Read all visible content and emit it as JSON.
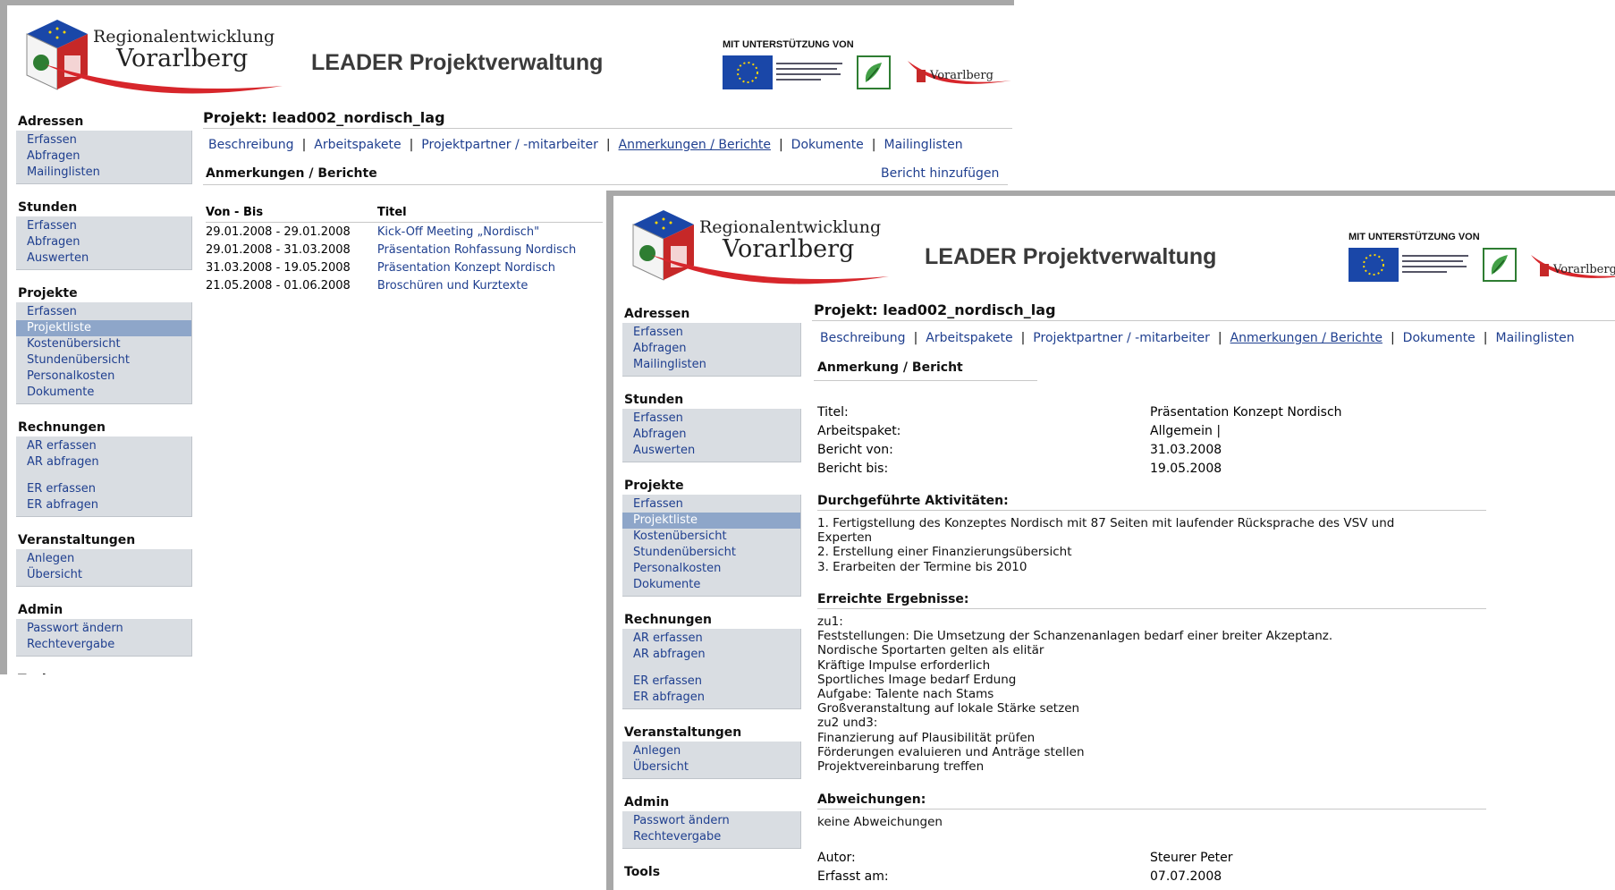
{
  "header": {
    "logo_line1": "Regionalentwicklung",
    "logo_line2": "Vorarlberg",
    "app_title": "LEADER Projektverwaltung",
    "support_label": "MIT UNTERSTÜTZUNG VON",
    "partner_label": "Vorarlberg"
  },
  "sidebar": {
    "adressen": {
      "title": "Adressen",
      "items": [
        "Erfassen",
        "Abfragen",
        "Mailinglisten"
      ]
    },
    "stunden": {
      "title": "Stunden",
      "items": [
        "Erfassen",
        "Abfragen",
        "Auswerten"
      ]
    },
    "projekte": {
      "title": "Projekte",
      "items": [
        "Erfassen",
        "Projektliste",
        "Kostenübersicht",
        "Stundenübersicht",
        "Personalkosten",
        "Dokumente"
      ]
    },
    "rechnungen": {
      "title": "Rechnungen",
      "items": [
        "AR erfassen",
        "AR abfragen",
        "ER erfassen",
        "ER abfragen"
      ]
    },
    "veranstaltungen": {
      "title": "Veranstaltungen",
      "items": [
        "Anlegen",
        "Übersicht"
      ]
    },
    "admin": {
      "title": "Admin",
      "items": [
        "Passwort ändern",
        "Rechtevergabe"
      ]
    },
    "tools": {
      "title": "Tools"
    }
  },
  "project": {
    "title": "Projekt: lead002_nordisch_lag",
    "tabs": [
      "Beschreibung",
      "Arbeitspakete",
      "Projektpartner / -mitarbeiter",
      "Anmerkungen / Berichte",
      "Dokumente",
      "Mailinglisten"
    ]
  },
  "list_view": {
    "subtitle": "Anmerkungen / Berichte",
    "add_link": "Bericht hinzufügen",
    "columns": [
      "Von - Bis",
      "Titel"
    ],
    "rows": [
      {
        "range": "29.01.2008 - 29.01.2008",
        "title": "Kick-Off Meeting „Nordisch\""
      },
      {
        "range": "29.01.2008 - 31.03.2008",
        "title": "Präsentation Rohfassung Nordisch"
      },
      {
        "range": "31.03.2008 - 19.05.2008",
        "title": "Präsentation Konzept Nordisch"
      },
      {
        "range": "21.05.2008 - 01.06.2008",
        "title": "Broschüren und Kurztexte"
      }
    ]
  },
  "detail_view": {
    "subtitle": "Anmerkung / Bericht",
    "fields": [
      {
        "k": "Titel:",
        "v": "Präsentation Konzept Nordisch"
      },
      {
        "k": "Arbeitspaket:",
        "v": "Allgemein |"
      },
      {
        "k": "Bericht von:",
        "v": "31.03.2008"
      },
      {
        "k": "Bericht bis:",
        "v": "19.05.2008"
      }
    ],
    "activities_title": "Durchgeführte Aktivitäten:",
    "activities": "1. Fertigstellung des Konzeptes Nordisch mit 87 Seiten mit laufender Rücksprache des VSV und\nExperten\n2. Erstellung einer Finanzierungsübersicht\n3. Erarbeiten der Termine bis 2010",
    "results_title": "Erreichte Ergebnisse:",
    "results": "zu1:\nFeststellungen: Die Umsetzung der Schanzenanlagen bedarf einer breiter Akzeptanz.\nNordische Sportarten gelten als elitär\nKräftige Impulse erforderlich\nSportliches Image bedarf Erdung\nAufgabe: Talente nach Stams\nGroßveranstaltung auf lokale Stärke setzen\nzu2 und3:\nFinanzierung auf Plausibilität prüfen\nFörderungen evaluieren und Anträge stellen\nProjektvereinbarung treffen",
    "deviations_title": "Abweichungen:",
    "deviations": "keine Abweichungen",
    "meta": [
      {
        "k": "Autor:",
        "v": "Steurer Peter"
      },
      {
        "k": "Erfasst am:",
        "v": "07.07.2008"
      }
    ]
  },
  "colors": {
    "link": "#1f3f8f",
    "nav_bg": "#d9dde2",
    "nav_active": "#8ea6c9",
    "swoosh": "#d7262b"
  }
}
